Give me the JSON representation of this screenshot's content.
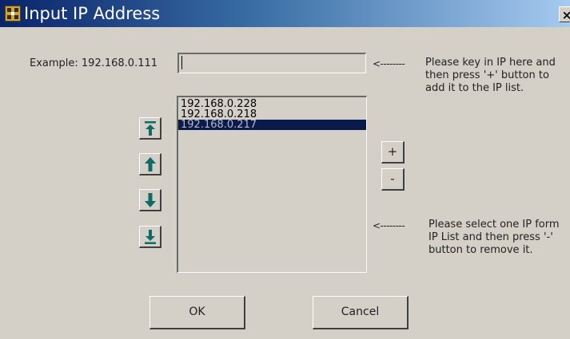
{
  "window": {
    "title": "Input IP Address",
    "close_label": "×"
  },
  "form": {
    "example_label": "Example: 192.168.0.111",
    "ip_value": "",
    "arrow_top": "<--------",
    "arrow_bottom": "<--------",
    "note_add": "Please key in IP here and\nthen press '+' button to\nadd it to the IP list.",
    "note_remove": "Please select one IP form\nIP List and then press '-'\nbutton to remove it."
  },
  "ip_list": {
    "items": [
      "192.168.0.228",
      "192.168.0.218",
      "192.168.0.217"
    ],
    "selected_index": 2
  },
  "buttons": {
    "add": "+",
    "remove": "-",
    "ok": "OK",
    "cancel": "Cancel"
  },
  "icons": {
    "move_top": "move-to-top-icon",
    "move_up": "move-up-icon",
    "move_down": "move-down-icon",
    "move_bottom": "move-to-bottom-icon"
  },
  "colors": {
    "title_gradient_start": "#0a246a",
    "title_gradient_end": "#a6caf0",
    "dialog_background": "#d4d0c8",
    "selected_item_background": "#0a1a4a",
    "arrow_icon": "#0f6b64"
  }
}
